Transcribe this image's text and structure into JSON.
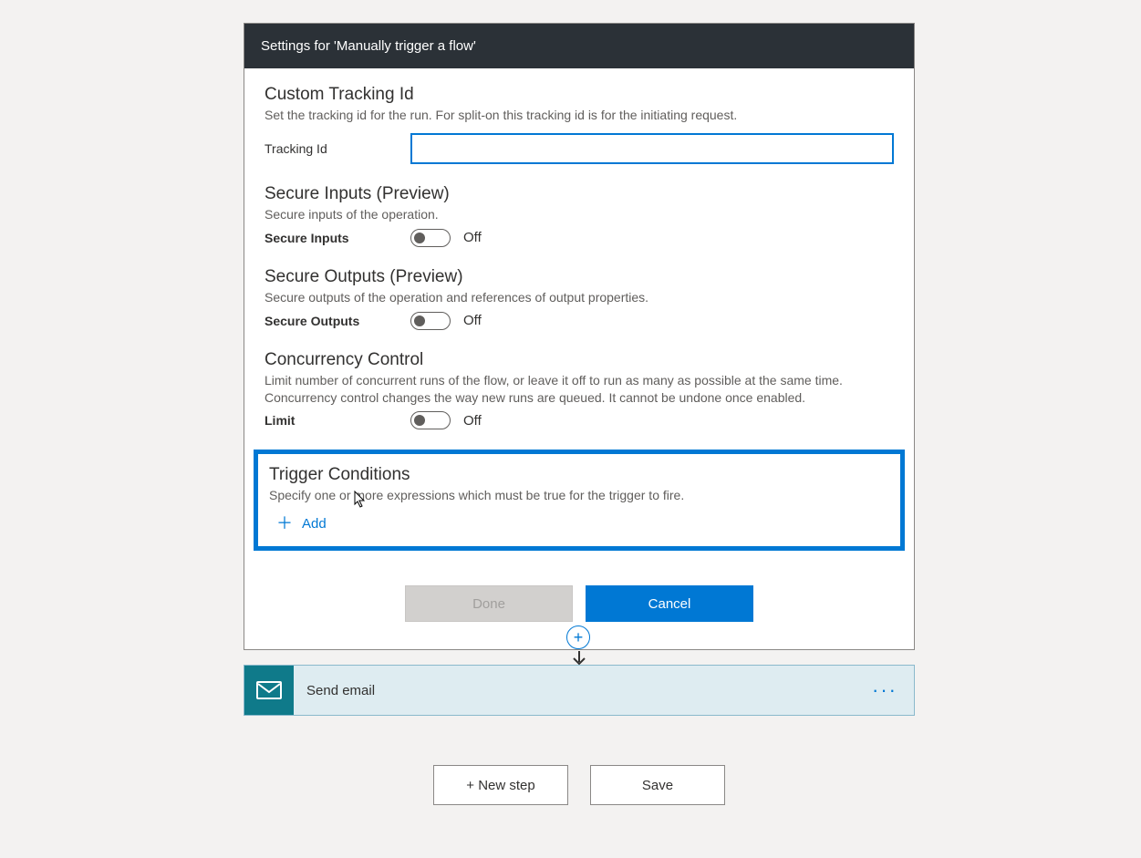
{
  "header": {
    "title": "Settings for 'Manually trigger a flow'"
  },
  "tracking": {
    "title": "Custom Tracking Id",
    "desc": "Set the tracking id for the run. For split-on this tracking id is for the initiating request.",
    "label": "Tracking Id",
    "value": ""
  },
  "secureInputs": {
    "title": "Secure Inputs (Preview)",
    "desc": "Secure inputs of the operation.",
    "label": "Secure Inputs",
    "state": "Off"
  },
  "secureOutputs": {
    "title": "Secure Outputs (Preview)",
    "desc": "Secure outputs of the operation and references of output properties.",
    "label": "Secure Outputs",
    "state": "Off"
  },
  "concurrency": {
    "title": "Concurrency Control",
    "desc": "Limit number of concurrent runs of the flow, or leave it off to run as many as possible at the same time. Concurrency control changes the way new runs are queued. It cannot be undone once enabled.",
    "label": "Limit",
    "state": "Off"
  },
  "triggerConditions": {
    "title": "Trigger Conditions",
    "desc": "Specify one or more expressions which must be true for the trigger to fire.",
    "add": "Add"
  },
  "buttons": {
    "done": "Done",
    "cancel": "Cancel"
  },
  "action": {
    "label": "Send email"
  },
  "bottom": {
    "newStep": "+ New step",
    "save": "Save"
  }
}
